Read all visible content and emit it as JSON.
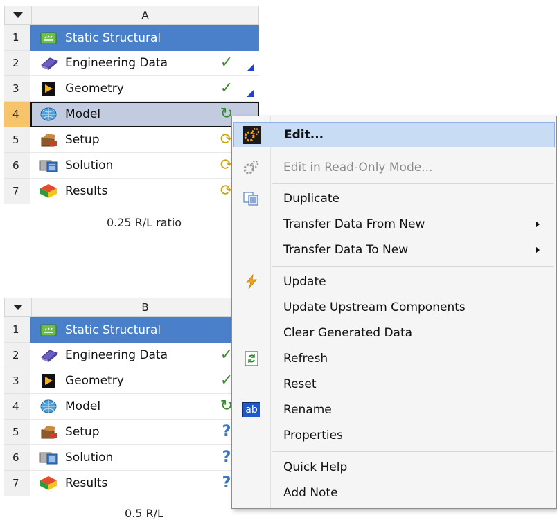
{
  "systems": [
    {
      "letter": "A",
      "caption": "0.25 R/L ratio",
      "rows": [
        {
          "num": "1",
          "label": "Static Structural",
          "icon": "static-structural-icon"
        },
        {
          "num": "2",
          "label": "Engineering Data",
          "icon": "engineering-data-icon",
          "status": "✓"
        },
        {
          "num": "3",
          "label": "Geometry",
          "icon": "geometry-icon",
          "status": "✓"
        },
        {
          "num": "4",
          "label": "Model",
          "icon": "model-icon",
          "status": "↻"
        },
        {
          "num": "5",
          "label": "Setup",
          "icon": "setup-icon",
          "status": "⟳"
        },
        {
          "num": "6",
          "label": "Solution",
          "icon": "solution-icon",
          "status": "⟳"
        },
        {
          "num": "7",
          "label": "Results",
          "icon": "results-icon",
          "status": "⟳"
        }
      ]
    },
    {
      "letter": "B",
      "caption": "0.5 R/L",
      "rows": [
        {
          "num": "1",
          "label": "Static Structural",
          "icon": "static-structural-icon"
        },
        {
          "num": "2",
          "label": "Engineering Data",
          "icon": "engineering-data-icon",
          "status": "✓"
        },
        {
          "num": "3",
          "label": "Geometry",
          "icon": "geometry-icon",
          "status": "✓"
        },
        {
          "num": "4",
          "label": "Model",
          "icon": "model-icon",
          "status": "↻"
        },
        {
          "num": "5",
          "label": "Setup",
          "icon": "setup-icon",
          "status": "?"
        },
        {
          "num": "6",
          "label": "Solution",
          "icon": "solution-icon",
          "status": "?"
        },
        {
          "num": "7",
          "label": "Results",
          "icon": "results-icon",
          "status": "?"
        }
      ]
    }
  ],
  "context_menu": {
    "items": [
      {
        "label": "Edit...",
        "icon": "gears-icon"
      },
      {
        "label": "Edit in Read-Only Mode...",
        "icon": "gears-disabled-icon"
      },
      {
        "label": "Duplicate",
        "icon": "duplicate-icon"
      },
      {
        "label": "Transfer Data From New"
      },
      {
        "label": "Transfer Data To New"
      },
      {
        "label": "Update",
        "icon": "lightning-icon"
      },
      {
        "label": "Update Upstream Components"
      },
      {
        "label": "Clear Generated Data"
      },
      {
        "label": "Refresh",
        "icon": "refresh-icon"
      },
      {
        "label": "Reset"
      },
      {
        "label": "Rename",
        "icon": "rename-icon",
        "icon_text": "ab"
      },
      {
        "label": "Properties"
      },
      {
        "label": "Quick Help"
      },
      {
        "label": "Add Note"
      }
    ]
  },
  "colors": {
    "title_row": "#4a7fc9",
    "selected_row": "#c3cbe0",
    "selected_number": "#f6c46a",
    "menu_highlight": "#c8ddf4"
  }
}
